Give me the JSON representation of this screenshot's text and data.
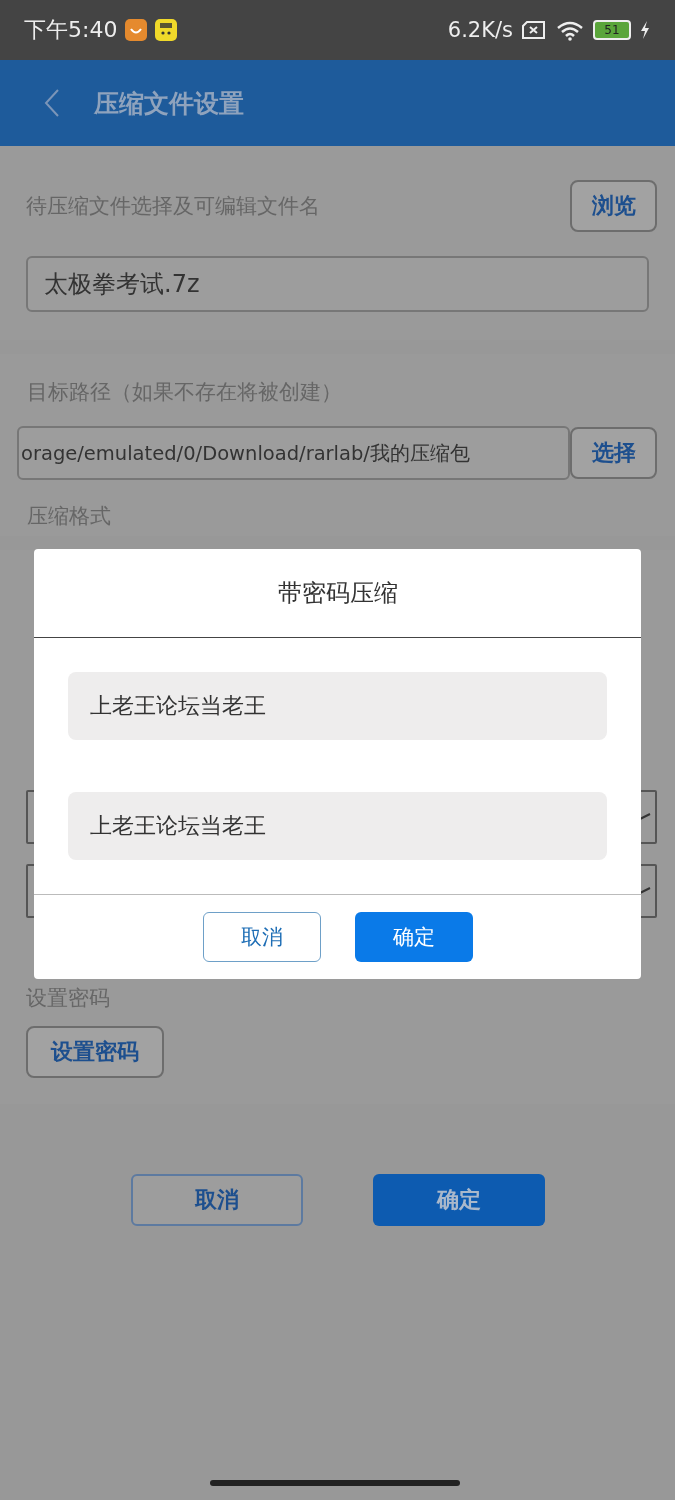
{
  "status_bar": {
    "time": "下午5:40",
    "net_speed": "6.2K/s",
    "battery": "51"
  },
  "app_bar": {
    "title": "压缩文件设置"
  },
  "archive": {
    "label": "待压缩文件选择及可编辑文件名",
    "browse_button": "浏览",
    "file_name": "太极拳考试.7z"
  },
  "destination": {
    "label": "目标路径（如果不存在将被创建）",
    "path": "orage/emulated/0/Download/rarlab/我的压缩包",
    "select_button": "选择"
  },
  "format": {
    "label": "压缩格式"
  },
  "password": {
    "label": "设置密码",
    "button": "设置密码"
  },
  "buttons": [
    {
      "label": "取消",
      "kind": "secondary"
    },
    {
      "label": "确定",
      "kind": "primary"
    }
  ],
  "dialog": {
    "title": "带密码压缩",
    "fields": [
      {
        "value": "上老王论坛当老王"
      },
      {
        "value": "上老王论坛当老王"
      }
    ],
    "buttons": [
      {
        "label": "取消",
        "kind": "secondary"
      },
      {
        "label": "确定",
        "kind": "primary"
      }
    ]
  }
}
